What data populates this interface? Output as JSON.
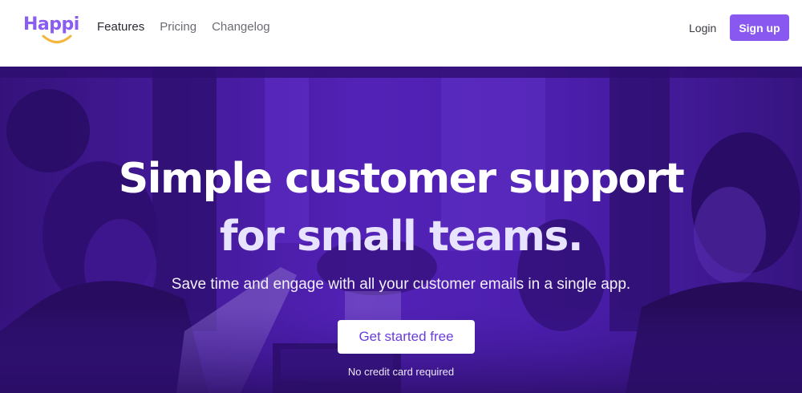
{
  "brand": {
    "name": "Happi",
    "color": "#8a5cf0"
  },
  "nav": {
    "items": [
      {
        "label": "Features",
        "active": true
      },
      {
        "label": "Pricing",
        "active": false
      },
      {
        "label": "Changelog",
        "active": false
      }
    ],
    "login_label": "Login",
    "signup_label": "Sign up"
  },
  "hero": {
    "headline_line1": "Simple customer support",
    "headline_line2": "for small teams.",
    "subtitle": "Save time and engage with all your customer emails in a single app.",
    "cta_label": "Get started free",
    "note": "No credit card required",
    "overlay_color": "#541ec8"
  }
}
